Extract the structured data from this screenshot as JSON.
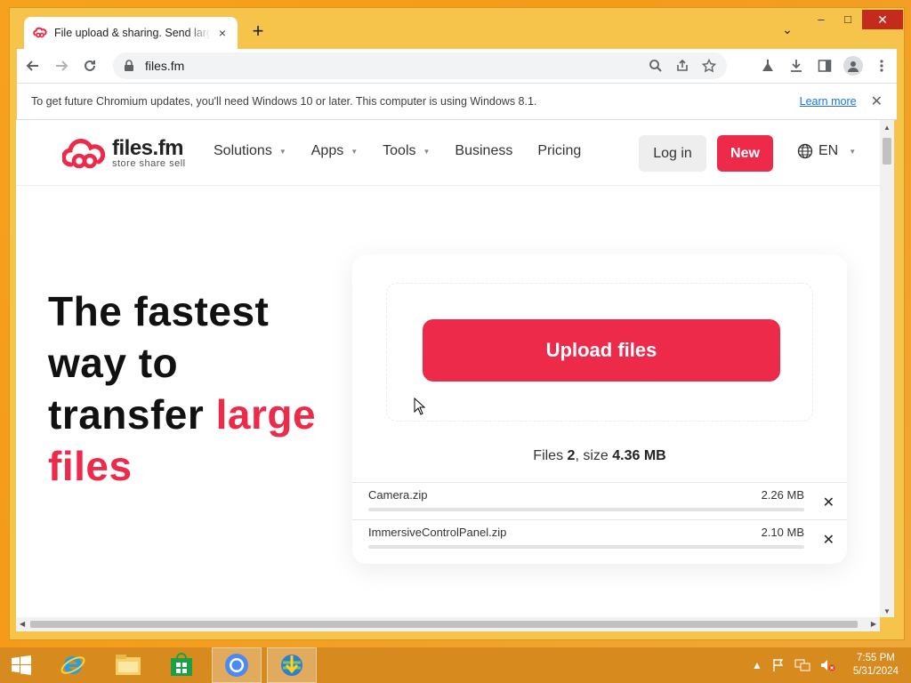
{
  "browser": {
    "tab_title": "File upload & sharing. Send large files",
    "tab_close": "×",
    "new_tab": "+",
    "tab_search": "⌄",
    "window_controls": {
      "minimize": "–",
      "maximize": "□",
      "close": "✕"
    },
    "url": "files.fm",
    "infobar": {
      "message": "To get future Chromium updates, you'll need Windows 10 or later. This computer is using Windows 8.1.",
      "link": "Learn more",
      "close": "✕"
    },
    "icons": [
      "back-icon",
      "forward-icon",
      "reload-icon",
      "lock-icon",
      "zoom-icon",
      "share-icon",
      "star-icon",
      "labs-icon",
      "download-icon",
      "side-panel-icon",
      "profile-icon",
      "menu-icon"
    ]
  },
  "site": {
    "logo": {
      "name": "files.fm",
      "tagline": "store share sell"
    },
    "nav": [
      {
        "label": "Solutions",
        "has_dropdown": true
      },
      {
        "label": "Apps",
        "has_dropdown": true
      },
      {
        "label": "Tools",
        "has_dropdown": true
      },
      {
        "label": "Business",
        "has_dropdown": false
      },
      {
        "label": "Pricing",
        "has_dropdown": false
      }
    ],
    "login_label": "Log in",
    "new_label": "New",
    "language": "EN",
    "hero": {
      "line1": "The fastest",
      "line2": "way to",
      "line3_plain": "transfer",
      "line3_accent": "large",
      "line4_accent": "files"
    },
    "upload": {
      "button_label": "Upload files",
      "summary_prefix": "Files",
      "file_count": "2",
      "summary_mid": ", size",
      "total_size": "4.36 MB",
      "files": [
        {
          "name": "Camera.zip",
          "size": "2.26 MB",
          "remove": "✕"
        },
        {
          "name": "ImmersiveControlPanel.zip",
          "size": "2.10 MB",
          "remove": "✕"
        }
      ]
    },
    "colors": {
      "accent": "#ee2a4b",
      "button_gray": "#eeeeee"
    }
  },
  "taskbar": {
    "apps": [
      "windows-start-icon",
      "internet-explorer-icon",
      "file-explorer-icon",
      "store-icon",
      "chromium-icon",
      "download-manager-icon"
    ],
    "clock_time": "7:55 PM",
    "clock_date": "5/31/2024"
  }
}
